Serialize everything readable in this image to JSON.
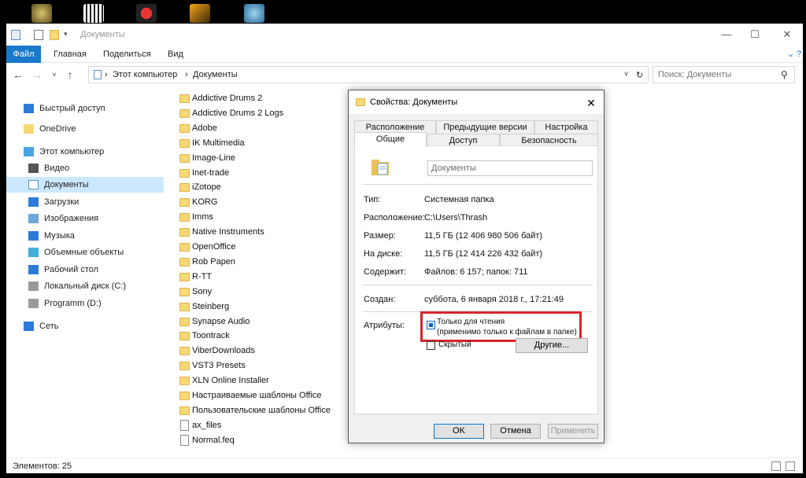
{
  "colors": {
    "accent": "#1979ca",
    "highlight": "#d9232d",
    "selected": "#cce8ff",
    "folder": "#f8d775"
  },
  "window": {
    "title": "Документы",
    "min": "—",
    "max": "☐",
    "close": "✕"
  },
  "ribbon": {
    "tabs": [
      "Файл",
      "Главная",
      "Поделиться",
      "Вид"
    ]
  },
  "address": {
    "crumbs": [
      "Этот компьютер",
      "Документы"
    ],
    "sep": "›",
    "search_placeholder": "Поиск: Документы"
  },
  "nav": [
    {
      "label": "Быстрый доступ",
      "icon": "star-icon"
    },
    {
      "label": "OneDrive",
      "icon": "folder-icon"
    },
    {
      "label": "Этот компьютер",
      "icon": "computer-icon"
    },
    {
      "label": "Видео",
      "icon": "video-icon"
    },
    {
      "label": "Документы",
      "icon": "document-icon",
      "selected": true
    },
    {
      "label": "Загрузки",
      "icon": "download-icon"
    },
    {
      "label": "Изображения",
      "icon": "image-icon"
    },
    {
      "label": "Музыка",
      "icon": "music-icon"
    },
    {
      "label": "Объемные объекты",
      "icon": "cube-icon"
    },
    {
      "label": "Рабочий стол",
      "icon": "desktop-icon"
    },
    {
      "label": "Локальный диск (C:)",
      "icon": "drive-icon"
    },
    {
      "label": "Programm (D:)",
      "icon": "drive-icon"
    },
    {
      "label": "Сеть",
      "icon": "network-icon"
    }
  ],
  "files": [
    "Addictive Drums 2",
    "Addictive Drums 2 Logs",
    "Adobe",
    "IK Multimedia",
    "Image-Line",
    "Inet-trade",
    "iZotope",
    "KORG",
    "Imms",
    "Native Instruments",
    "OpenOffice",
    "Rob Papen",
    "R-TT",
    "Sony",
    "Steinberg",
    "Synapse Audio",
    "Toontrack",
    "ViberDownloads",
    "VST3 Presets",
    "XLN Online Installer",
    "Настраиваемые шаблоны Office",
    "Пользовательские шаблоны Office",
    "ax_files",
    "Normal.feq"
  ],
  "status": {
    "text": "Элементов: 25"
  },
  "dialog": {
    "title": "Свойства: Документы",
    "tabs_top": [
      "Расположение",
      "Предыдущие версии",
      "Настройка"
    ],
    "tabs_bottom": [
      "Общие",
      "Доступ",
      "Безопасность"
    ],
    "name_value": "Документы",
    "props": [
      {
        "label": "Тип:",
        "value": "Системная папка"
      },
      {
        "label": "Расположение:",
        "value": "C:\\Users\\Thrash"
      },
      {
        "label": "Размер:",
        "value": "11,5 ГБ (12 406 980 506 байт)"
      },
      {
        "label": "На диске:",
        "value": "11,5 ГБ (12 414 226 432 байт)"
      },
      {
        "label": "Содержит:",
        "value": "Файлов: 6 157; папок: 711"
      }
    ],
    "created_label": "Создан:",
    "created_value": "суббота, 6 января 2018 г., 17:21:49",
    "attributes_label": "Атрибуты:",
    "readonly_line1": "Только для чтения",
    "readonly_line2": "(применимо только к файлам в папке)",
    "hidden_label": "Скрытый",
    "other_btn": "Другие...",
    "ok": "OK",
    "cancel": "Отмена",
    "apply": "Применить"
  }
}
